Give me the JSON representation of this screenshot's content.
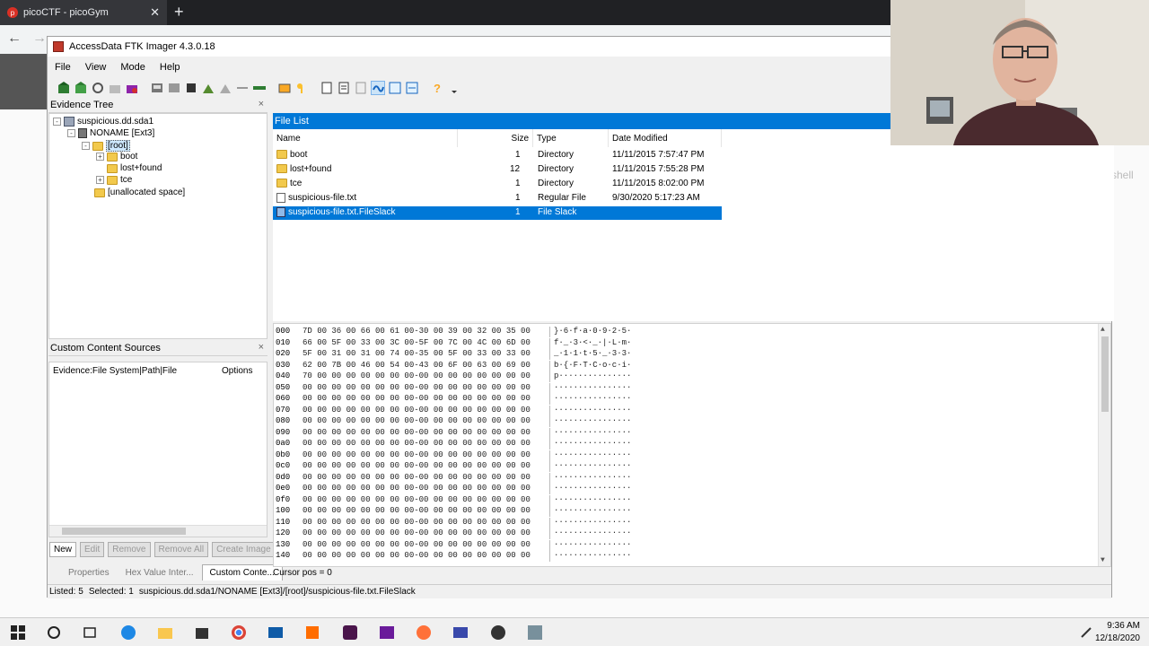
{
  "browser": {
    "tab_title": "picoCTF - picoGym",
    "tab_favicon": "p",
    "tab_close": "✕",
    "new_tab": "+",
    "back_icon": "←",
    "forward_icon": "→",
    "page_fragment": "shell"
  },
  "ftk": {
    "title": "AccessData FTK Imager 4.3.0.18",
    "menu": [
      "File",
      "View",
      "Mode",
      "Help"
    ],
    "evidence_tree": {
      "header": "Evidence Tree",
      "close": "×",
      "nodes": {
        "image": "suspicious.dd.sda1",
        "partition": "NONAME [Ext3]",
        "root": "[root]",
        "boot": "boot",
        "lost_found": "lost+found",
        "tce": "tce",
        "unallocated": "[unallocated space]"
      },
      "expander_minus": "-",
      "expander_plus": "+"
    },
    "custom_content": {
      "header": "Custom Content Sources",
      "close": "×",
      "col_evidence": "Evidence:File System|Path|File",
      "col_options": "Options",
      "buttons": [
        "New",
        "Edit",
        "Remove",
        "Remove All",
        "Create Image"
      ],
      "tabs": [
        "Properties",
        "Hex Value Inter...",
        "Custom Conte..."
      ]
    },
    "file_list": {
      "header": "File List",
      "columns": [
        "Name",
        "Size",
        "Type",
        "Date Modified"
      ],
      "rows": [
        {
          "name": "boot",
          "size": "1",
          "type": "Directory",
          "date": "11/11/2015 7:57:47 PM",
          "icon": "folder-icon"
        },
        {
          "name": "lost+found",
          "size": "12",
          "type": "Directory",
          "date": "11/11/2015 7:55:28 PM",
          "icon": "folder-icon"
        },
        {
          "name": "tce",
          "size": "1",
          "type": "Directory",
          "date": "11/11/2015 8:02:00 PM",
          "icon": "folder-icon"
        },
        {
          "name": "suspicious-file.txt",
          "size": "1",
          "type": "Regular File",
          "date": "9/30/2020 5:17:23 AM",
          "icon": "file-icon"
        },
        {
          "name": "suspicious-file.txt.FileSlack",
          "size": "1",
          "type": "File Slack",
          "date": "",
          "icon": "slack-file-icon",
          "selected": true
        }
      ]
    },
    "hex": {
      "lines": [
        {
          "off": "000",
          "bytes": "7D 00 36 00 66 00 61 00-30 00 39 00 32 00 35 00",
          "ascii": "}·6·f·a·0·9·2·5·"
        },
        {
          "off": "010",
          "bytes": "66 00 5F 00 33 00 3C 00-5F 00 7C 00 4C 00 6D 00",
          "ascii": "f·_·3·<·_·|·L·m·"
        },
        {
          "off": "020",
          "bytes": "5F 00 31 00 31 00 74 00-35 00 5F 00 33 00 33 00",
          "ascii": "_·1·1·t·5·_·3·3·"
        },
        {
          "off": "030",
          "bytes": "62 00 7B 00 46 00 54 00-43 00 6F 00 63 00 69 00",
          "ascii": "b·{·F·T·C·o·c·i·"
        },
        {
          "off": "040",
          "bytes": "70 00 00 00 00 00 00 00-00 00 00 00 00 00 00 00",
          "ascii": "p···············"
        },
        {
          "off": "050",
          "bytes": "00 00 00 00 00 00 00 00-00 00 00 00 00 00 00 00",
          "ascii": "················"
        },
        {
          "off": "060",
          "bytes": "00 00 00 00 00 00 00 00-00 00 00 00 00 00 00 00",
          "ascii": "················"
        },
        {
          "off": "070",
          "bytes": "00 00 00 00 00 00 00 00-00 00 00 00 00 00 00 00",
          "ascii": "················"
        },
        {
          "off": "080",
          "bytes": "00 00 00 00 00 00 00 00-00 00 00 00 00 00 00 00",
          "ascii": "················"
        },
        {
          "off": "090",
          "bytes": "00 00 00 00 00 00 00 00-00 00 00 00 00 00 00 00",
          "ascii": "················"
        },
        {
          "off": "0a0",
          "bytes": "00 00 00 00 00 00 00 00-00 00 00 00 00 00 00 00",
          "ascii": "················"
        },
        {
          "off": "0b0",
          "bytes": "00 00 00 00 00 00 00 00-00 00 00 00 00 00 00 00",
          "ascii": "················"
        },
        {
          "off": "0c0",
          "bytes": "00 00 00 00 00 00 00 00-00 00 00 00 00 00 00 00",
          "ascii": "················"
        },
        {
          "off": "0d0",
          "bytes": "00 00 00 00 00 00 00 00-00 00 00 00 00 00 00 00",
          "ascii": "················"
        },
        {
          "off": "0e0",
          "bytes": "00 00 00 00 00 00 00 00-00 00 00 00 00 00 00 00",
          "ascii": "················"
        },
        {
          "off": "0f0",
          "bytes": "00 00 00 00 00 00 00 00-00 00 00 00 00 00 00 00",
          "ascii": "················"
        },
        {
          "off": "100",
          "bytes": "00 00 00 00 00 00 00 00-00 00 00 00 00 00 00 00",
          "ascii": "················"
        },
        {
          "off": "110",
          "bytes": "00 00 00 00 00 00 00 00-00 00 00 00 00 00 00 00",
          "ascii": "················"
        },
        {
          "off": "120",
          "bytes": "00 00 00 00 00 00 00 00-00 00 00 00 00 00 00 00",
          "ascii": "················"
        },
        {
          "off": "130",
          "bytes": "00 00 00 00 00 00 00 00-00 00 00 00 00 00 00 00",
          "ascii": "················"
        },
        {
          "off": "140",
          "bytes": "00 00 00 00 00 00 00 00-00 00 00 00 00 00 00 00",
          "ascii": "················"
        }
      ],
      "cursor_pos": "Cursor pos = 0"
    },
    "status": {
      "listed": "Listed: 5",
      "selected": "Selected: 1",
      "path": "suspicious.dd.sda1/NONAME [Ext3]/[root]/suspicious-file.txt.FileSlack"
    }
  },
  "taskbar": {
    "time": "9:36 AM",
    "date": "12/18/2020"
  },
  "colors": {
    "selection": "#0078d7",
    "folder": "#f2c94c"
  }
}
